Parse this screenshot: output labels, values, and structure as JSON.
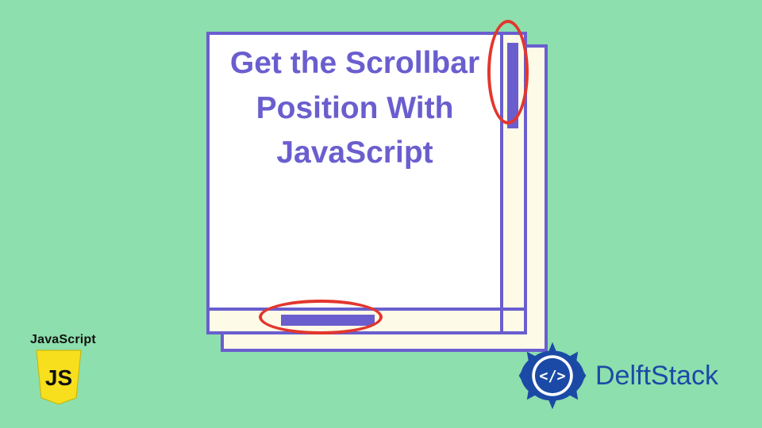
{
  "colors": {
    "bg": "#8ddfad",
    "primary": "#6a5ecf",
    "cream": "#fdfbe7",
    "highlight": "#e3362d",
    "jsYellow": "#f7df1e",
    "delftBlue": "#1b4aa6"
  },
  "card": {
    "title": "Get the Scrollbar Position With JavaScript"
  },
  "jsBadge": {
    "label": "JavaScript",
    "letters": "JS"
  },
  "brand": {
    "name": "DelftStack",
    "codeGlyph": "</>"
  }
}
